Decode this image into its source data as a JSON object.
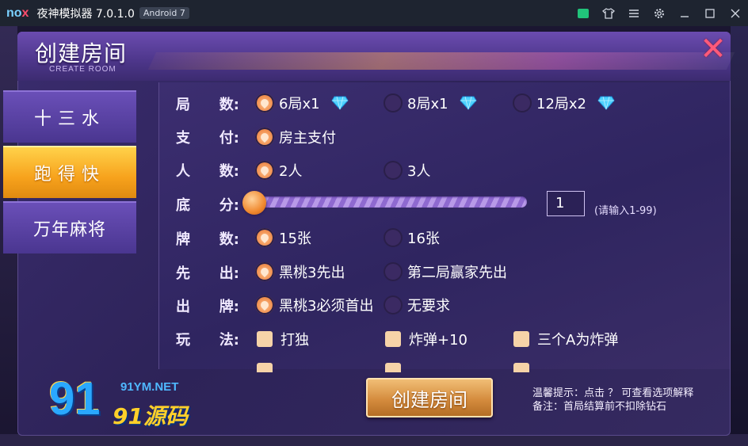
{
  "window": {
    "logo_text_no": "no",
    "logo_text_x": "x",
    "title": "夜神模拟器 7.0.1.0",
    "badge": "Android 7",
    "icons": [
      "store-icon",
      "shirt-icon",
      "menu-icon",
      "settings-icon",
      "minimize-icon",
      "maximize-icon",
      "close-icon"
    ],
    "accent": "#21c37a"
  },
  "dialog": {
    "title": "创建房间",
    "subtitle": "CREATE ROOM",
    "close_symbol": "✕"
  },
  "tabs": [
    {
      "label": "十三水",
      "active": false
    },
    {
      "label": "跑得快",
      "active": true
    },
    {
      "label": "万年麻将",
      "active": false
    }
  ],
  "settings": {
    "rounds": {
      "label_a": "局",
      "label_b": "数:",
      "options": [
        {
          "text": "6局x1",
          "selected": true
        },
        {
          "text": "8局x1",
          "selected": false
        },
        {
          "text": "12局x2",
          "selected": false
        }
      ]
    },
    "payment": {
      "label_a": "支",
      "label_b": "付:",
      "options": [
        {
          "text": "房主支付",
          "selected": true
        }
      ]
    },
    "players": {
      "label_a": "人",
      "label_b": "数:",
      "options": [
        {
          "text": "2人",
          "selected": true
        },
        {
          "text": "3人",
          "selected": false
        }
      ]
    },
    "base_score": {
      "label_a": "底",
      "label_b": "分:",
      "value": "1",
      "hint": "(请输入1-99)",
      "slider_fraction": 0.0
    },
    "cards": {
      "label_a": "牌",
      "label_b": "数:",
      "options": [
        {
          "text": "15张",
          "selected": true
        },
        {
          "text": "16张",
          "selected": false
        }
      ]
    },
    "first_play": {
      "label_a": "先",
      "label_b": "出:",
      "options": [
        {
          "text": "黑桃3先出",
          "selected": true
        },
        {
          "text": "第二局赢家先出",
          "selected": false
        }
      ]
    },
    "play_card": {
      "label_a": "出",
      "label_b": "牌:",
      "options": [
        {
          "text": "黑桃3必须首出",
          "selected": true
        },
        {
          "text": "无要求",
          "selected": false
        }
      ]
    },
    "rules": {
      "label_a": "玩",
      "label_b": "法:",
      "options": [
        {
          "text": "打独"
        },
        {
          "text": "炸弹+10"
        },
        {
          "text": "三个A为炸弹"
        }
      ]
    }
  },
  "create_button": "创建房间",
  "tips": {
    "line1": "温馨提示：点击 ？ 可查看选项解释",
    "line2": "备注：首局结算前不扣除钻石"
  },
  "watermark": {
    "url": "91YM.NET",
    "cn": "91源码",
    "num": "91"
  }
}
